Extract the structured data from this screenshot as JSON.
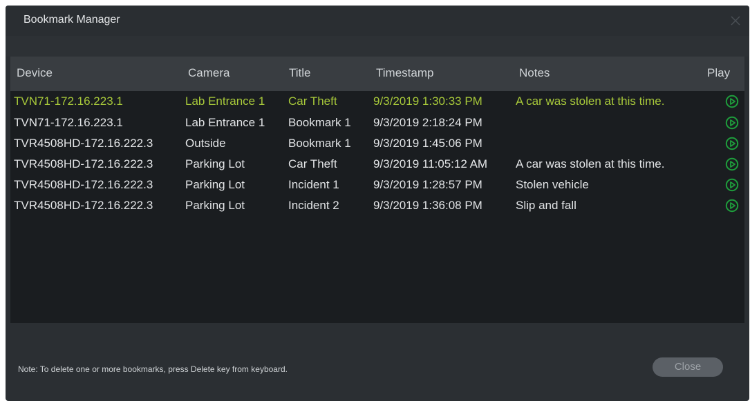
{
  "window": {
    "title": "Bookmark Manager"
  },
  "table": {
    "columns": [
      "Device",
      "Camera",
      "Title",
      "Timestamp",
      "Notes",
      "Play"
    ],
    "rows": [
      {
        "device": "TVN71-172.16.223.1",
        "camera": "Lab Entrance 1",
        "title": "Car Theft",
        "timestamp": "9/3/2019 1:30:33 PM",
        "notes": "A car was stolen at this time.",
        "selected": true
      },
      {
        "device": "TVN71-172.16.223.1",
        "camera": "Lab Entrance 1",
        "title": "Bookmark 1",
        "timestamp": "9/3/2019 2:18:24 PM",
        "notes": "",
        "selected": false
      },
      {
        "device": "TVR4508HD-172.16.222.3",
        "camera": "Outside",
        "title": "Bookmark 1",
        "timestamp": "9/3/2019 1:45:06 PM",
        "notes": "",
        "selected": false
      },
      {
        "device": "TVR4508HD-172.16.222.3",
        "camera": "Parking Lot",
        "title": "Car Theft",
        "timestamp": "9/3/2019 11:05:12 AM",
        "notes": "A car was stolen at this time.",
        "selected": false
      },
      {
        "device": "TVR4508HD-172.16.222.3",
        "camera": "Parking Lot",
        "title": "Incident 1",
        "timestamp": "9/3/2019 1:28:57 PM",
        "notes": "Stolen vehicle",
        "selected": false
      },
      {
        "device": "TVR4508HD-172.16.222.3",
        "camera": "Parking Lot",
        "title": "Incident 2",
        "timestamp": "9/3/2019 1:36:08 PM",
        "notes": "Slip and fall",
        "selected": false
      }
    ]
  },
  "footer": {
    "note": "Note: To delete one or more bookmarks, press Delete key from keyboard.",
    "close_label": "Close"
  },
  "icons": {
    "close": "close-icon",
    "play": "play-icon"
  },
  "colors": {
    "selected_text": "#a8c93a",
    "play_icon": "#1e9e3c",
    "background": "#2b2f33",
    "table_bg": "#1a1d20"
  }
}
